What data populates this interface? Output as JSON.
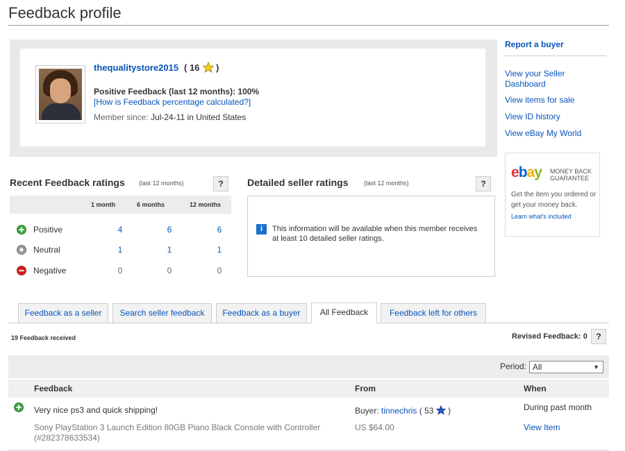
{
  "page": {
    "title": "Feedback profile"
  },
  "profile": {
    "username": "thequalitystore2015",
    "score_text": "( 16",
    "score_close": ")",
    "positive_feedback": "Positive Feedback (last 12 months): 100%",
    "how_calculated_link": "[How is Feedback percentage calculated?]",
    "member_since_label": "Member since:",
    "member_since_value": "Jul-24-11 in United States"
  },
  "sidebar": {
    "report_buyer": "Report a buyer",
    "links": [
      "View your Seller Dashboard",
      "View items for sale",
      "View ID history",
      "View eBay My World"
    ],
    "guarantee": {
      "logo": {
        "e": "e",
        "b": "b",
        "a": "a",
        "y": "y"
      },
      "badge_line1": "MONEY BACK",
      "badge_line2": "GUARANTEE",
      "text": "Get the item you ordered or get your money back.",
      "link": "Learn what's included"
    }
  },
  "recent_ratings": {
    "title": "Recent Feedback ratings",
    "subtitle": "(last 12 months)",
    "help": "?",
    "columns": [
      "1 month",
      "6 months",
      "12 months"
    ],
    "rows": [
      {
        "label": "Positive",
        "icon": "positive-plus-icon",
        "values": [
          "4",
          "6",
          "6"
        ],
        "color": "#3ea63e"
      },
      {
        "label": "Neutral",
        "icon": "neutral-dot-icon",
        "values": [
          "1",
          "1",
          "1"
        ],
        "color": "#888888"
      },
      {
        "label": "Negative",
        "icon": "negative-minus-icon",
        "values": [
          "0",
          "0",
          "0"
        ],
        "color": "#d6201f"
      }
    ]
  },
  "detailed_ratings": {
    "title": "Detailed seller ratings",
    "subtitle": "(last 12 months)",
    "help": "?",
    "info_icon": "i",
    "message": "This information will be available when this member receives at least 10 detailed seller ratings."
  },
  "tabs": [
    {
      "label": "Feedback as a seller",
      "active": false
    },
    {
      "label": "Search seller feedback",
      "active": false
    },
    {
      "label": "Feedback as a buyer",
      "active": false
    },
    {
      "label": "All Feedback",
      "active": true
    },
    {
      "label": "Feedback left for others",
      "active": false
    }
  ],
  "summary": {
    "received": "19 Feedback received",
    "revised": "Revised Feedback: 0",
    "help": "?"
  },
  "period": {
    "label": "Period:",
    "selected": "All",
    "caret": "▼"
  },
  "table": {
    "headers": {
      "feedback": "Feedback",
      "from": "From",
      "when": "When"
    },
    "rows": [
      {
        "comment": "Very nice ps3 and quick shipping!",
        "item": "Sony PlayStation 3 Launch Edition 80GB Piano Black Console with Controller (#282378633534)",
        "from_prefix": "Buyer:",
        "from_user": "tinnechris",
        "from_score": "( 53",
        "from_close": ")",
        "price": "US $64.00",
        "when": "During past month",
        "view_item": "View Item"
      }
    ]
  },
  "colors": {
    "link": "#0654ba",
    "star_yellow": "#f7d117",
    "star_blue": "#1f56c9"
  }
}
